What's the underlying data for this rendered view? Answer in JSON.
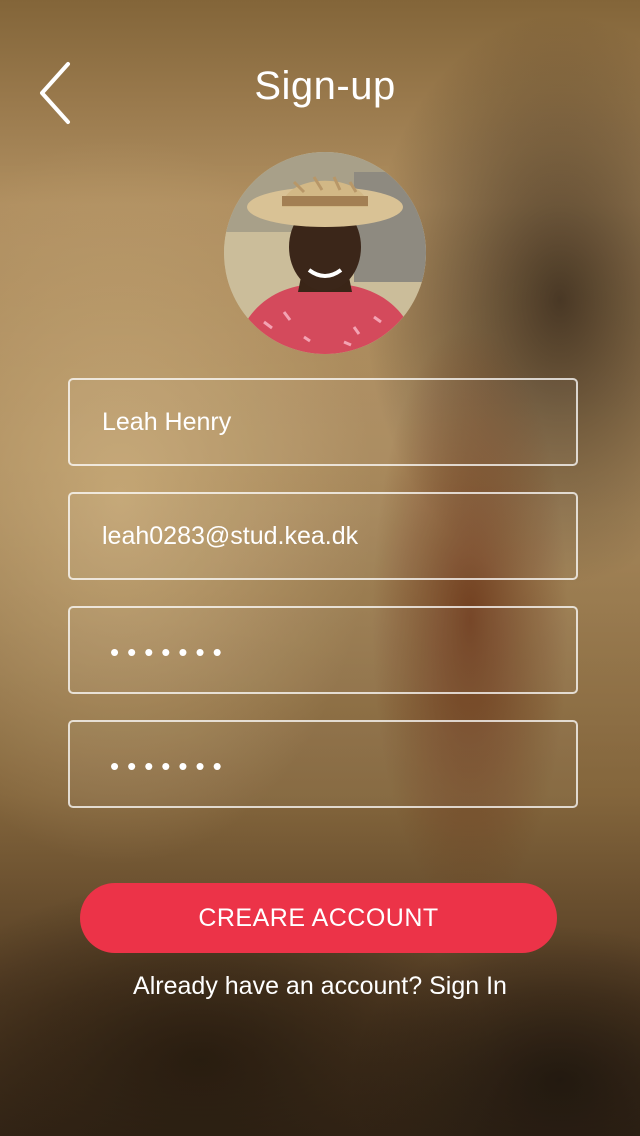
{
  "header": {
    "title": "Sign-up",
    "back_icon": "chevron-left-icon"
  },
  "form": {
    "name_value": "Leah Henry",
    "email_value": "leah0283@stud.kea.dk",
    "password_value": "•••••••",
    "confirm_password_value": "•••••••"
  },
  "actions": {
    "create_label": "CREARE ACCOUNT",
    "signin_prompt": "Already have an account?",
    "signin_link": "Sign In"
  },
  "colors": {
    "accent": "#ec3348",
    "text": "#ffffff",
    "field_border": "#ffffff"
  }
}
